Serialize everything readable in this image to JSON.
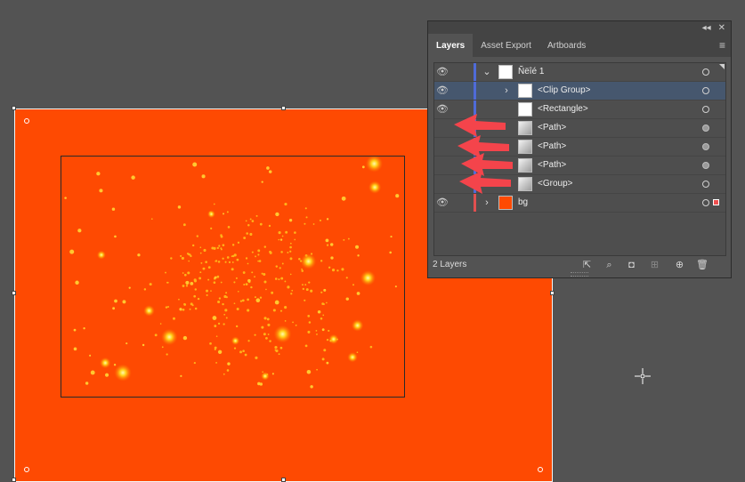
{
  "panel": {
    "tabs": [
      "Layers",
      "Asset Export",
      "Artboards"
    ],
    "active_tab": "Layers",
    "top_icons": [
      "collapse-icon",
      "close-icon"
    ],
    "menu_icon": "panel-menu-icon",
    "layers": [
      {
        "label": "Ñëîé 1",
        "visible": true,
        "expanded": true,
        "indent": 0,
        "thumb": "white",
        "target": "hollow",
        "selected": false,
        "bar_color": "#4f6bd8"
      },
      {
        "label": "<Clip Group>",
        "visible": true,
        "expanded": false,
        "indent": 1,
        "thumb": "white",
        "target": "hollow",
        "selected": true,
        "bar_color": "#4f6bd8"
      },
      {
        "label": "<Rectangle>",
        "visible": true,
        "indent": 1,
        "thumb": "white",
        "target": "hollow",
        "selected": false,
        "bar_color": "#4f6bd8"
      },
      {
        "label": "<Path>",
        "visible": false,
        "indent": 1,
        "thumb": "gray",
        "target": "filled",
        "selected": false,
        "bar_color": "#4f6bd8"
      },
      {
        "label": "<Path>",
        "visible": false,
        "indent": 1,
        "thumb": "gray",
        "target": "filled",
        "selected": false,
        "bar_color": "#4f6bd8"
      },
      {
        "label": "<Path>",
        "visible": false,
        "indent": 1,
        "thumb": "gray",
        "target": "filled",
        "selected": false,
        "bar_color": "#4f6bd8"
      },
      {
        "label": "<Group>",
        "visible": false,
        "expanded": false,
        "indent": 1,
        "thumb": "gray",
        "target": "hollow",
        "selected": false,
        "bar_color": "#4f6bd8"
      },
      {
        "label": "bg",
        "visible": true,
        "expanded": false,
        "indent": 0,
        "thumb": "orange",
        "target": "hollow",
        "selected": false,
        "bar_color": "#e05050",
        "selection_color": "#ee4f4f"
      }
    ],
    "layer_count": "2 Layers",
    "footer_icons": [
      "export-icon",
      "locate-object-icon",
      "make-clipping-mask-icon",
      "new-sublayer-icon",
      "new-layer-icon",
      "trash-icon"
    ]
  },
  "colors": {
    "artboard_fill": "#fe4a02",
    "workspace": "#535353",
    "annotation_arrow": "#f4444b"
  },
  "annotations": {
    "arrow_count": 4
  }
}
